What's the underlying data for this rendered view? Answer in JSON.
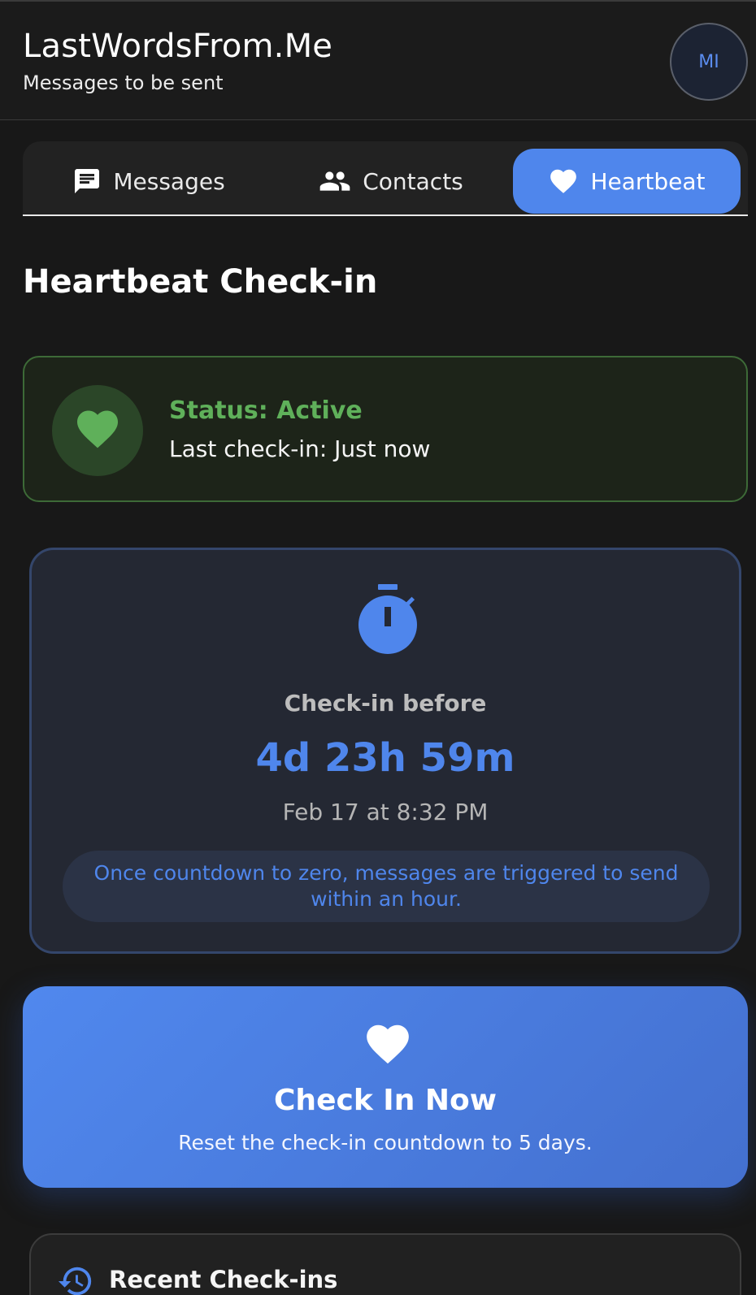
{
  "header": {
    "title": "LastWordsFrom.Me",
    "subtitle": "Messages to be sent",
    "avatar_initials": "MI"
  },
  "tabs": [
    {
      "label": "Messages",
      "icon": "message-icon",
      "active": false
    },
    {
      "label": "Contacts",
      "icon": "people-icon",
      "active": false
    },
    {
      "label": "Heartbeat",
      "icon": "heart-icon",
      "active": true
    }
  ],
  "page_title": "Heartbeat Check-in",
  "status": {
    "text": "Status: Active",
    "last_checkin": "Last check-in: Just now",
    "color": "#5fb05a"
  },
  "countdown": {
    "label": "Check-in before",
    "value": "4d 23h 59m",
    "deadline": "Feb 17 at 8:32 PM",
    "info": "Once countdown to zero, messages are triggered to send within an hour.",
    "icon": "timer-icon"
  },
  "checkin_button": {
    "title": "Check In Now",
    "subtitle": "Reset the check-in countdown to 5 days.",
    "icon": "heart-icon"
  },
  "recent": {
    "title": "Recent Check-ins",
    "icon": "history-icon"
  },
  "colors": {
    "accent": "#4f86ec",
    "active_green": "#5fb05a",
    "background": "#181818"
  }
}
